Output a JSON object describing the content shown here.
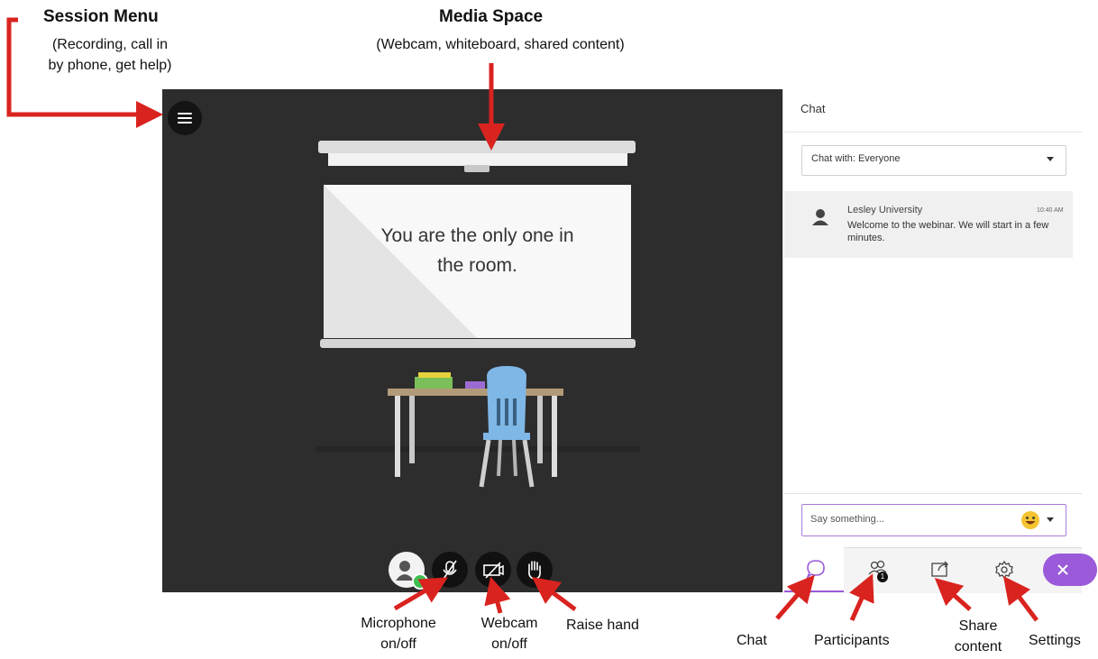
{
  "annotations": {
    "session_menu": {
      "title": "Session Menu",
      "line1": "(Recording, call in",
      "line2": "by phone, get help)"
    },
    "media_space": {
      "title": "Media Space",
      "subtitle": "(Webcam, whiteboard, shared content)"
    },
    "microphone": {
      "line1": "Microphone",
      "line2": "on/off"
    },
    "webcam": {
      "line1": "Webcam",
      "line2": "on/off"
    },
    "raise_hand": "Raise hand",
    "chat": "Chat",
    "participants": "Participants",
    "share_content": {
      "line1": "Share",
      "line2": "content"
    },
    "settings": "Settings",
    "arrow_color": "#d9231f"
  },
  "stage": {
    "whiteboard_text_line1": "You are the only one in",
    "whiteboard_text_line2": "the room."
  },
  "chat_panel": {
    "title": "Chat",
    "chat_with": "Chat with: Everyone",
    "message": {
      "author": "Lesley University",
      "time": "10:40 AM",
      "text": "Welcome to the webinar. We will start in a few minutes."
    },
    "input_placeholder": "Say something...",
    "participant_count": "1"
  },
  "colors": {
    "accent": "#9a5ad9",
    "stage_bg": "#2d2d2d",
    "status_green": "#3cbf4e"
  },
  "icons": [
    "menu-icon",
    "chat-bubble-icon",
    "participants-icon",
    "share-icon",
    "gear-icon",
    "close-icon",
    "microphone-off-icon",
    "camera-off-icon",
    "hand-icon",
    "avatar-icon",
    "emoji-icon",
    "chevron-down-icon"
  ]
}
